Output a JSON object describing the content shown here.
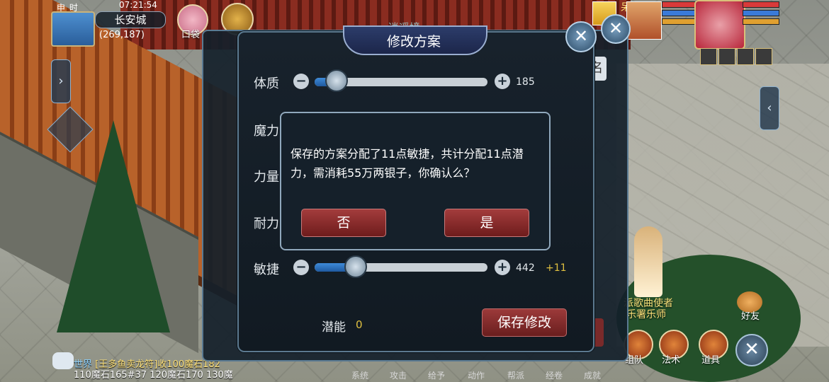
{
  "hud": {
    "time_label": "申 时",
    "clock": "07:21:54",
    "city": "长安城",
    "coords": "(269,187)",
    "bag_label": "口袋",
    "pet_name": "呆"
  },
  "back_panel": {
    "tab_partial": "逍遥境",
    "name_btn_partial": "名"
  },
  "panel": {
    "title": "修改方案",
    "attributes": [
      {
        "label": "体质",
        "value": "185",
        "bonus": "",
        "fill": 0.12
      },
      {
        "label": "魔力",
        "value": "",
        "bonus": "",
        "fill": 0
      },
      {
        "label": "力量",
        "value": "",
        "bonus": "",
        "fill": 0
      },
      {
        "label": "耐力",
        "value": "",
        "bonus": "",
        "fill": 0
      },
      {
        "label": "敏捷",
        "value": "442",
        "bonus": "+11",
        "fill": 0.23
      }
    ],
    "potential_label": "潜能",
    "potential_value": "0",
    "save_label": "保存修改"
  },
  "dialog": {
    "message": "保存的方案分配了11点敏捷，共计分配11点潜力，需消耗55万两银子，你确认么？",
    "no_label": "否",
    "yes_label": "是"
  },
  "npc": {
    "title": "派歌曲使者",
    "name": "乐署乐师"
  },
  "friends_label": "好友",
  "bottom_buttons": [
    {
      "label": "组队"
    },
    {
      "label": "法术"
    },
    {
      "label": "道具"
    }
  ],
  "skill_labels": [
    "系统",
    "攻击",
    "给予",
    "动作",
    "帮派",
    "经卷",
    "成就"
  ],
  "chat": {
    "channel": "世界",
    "message_line1": "[王多鱼卖龙符]收100魔石182",
    "message_line2": "110魔石165#37 120魔石170 130魔"
  },
  "colors": {
    "accent_red": "#8a2c2c",
    "slider_blue": "#2f74c2",
    "gold": "#e0c040"
  }
}
